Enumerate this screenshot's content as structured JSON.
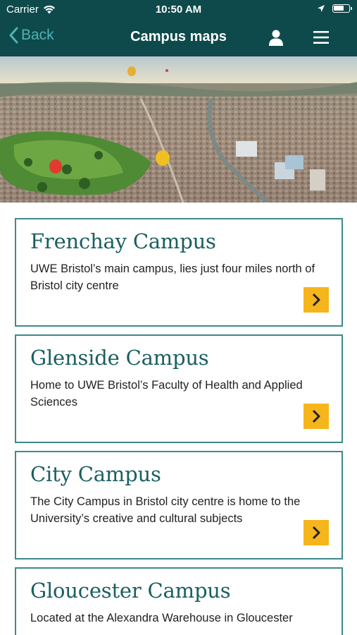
{
  "status_bar": {
    "carrier": "Carrier",
    "time": "10:50 AM"
  },
  "nav": {
    "back_label": "Back",
    "title": "Campus maps",
    "icons": [
      "user-icon",
      "hamburger-menu-icon"
    ]
  },
  "colors": {
    "header_bg": "#0e4a4b",
    "accent_teal": "#4fb3b3",
    "card_border": "#3d8a8c",
    "heading": "#1b5f60",
    "arrow_button": "#f5b51b"
  },
  "campuses": [
    {
      "name": "Frenchay Campus",
      "description": "UWE Bristol’s main campus, lies just four miles north of Bristol city centre"
    },
    {
      "name": "Glenside Campus",
      "description": "Home to UWE Bristol’s Faculty of Health and Applied Sciences"
    },
    {
      "name": "City Campus",
      "description": "The City Campus in Bristol city centre is home to the University’s creative and cultural subjects"
    },
    {
      "name": "Gloucester Campus",
      "description": "Located at the Alexandra Warehouse in Gloucester"
    }
  ]
}
